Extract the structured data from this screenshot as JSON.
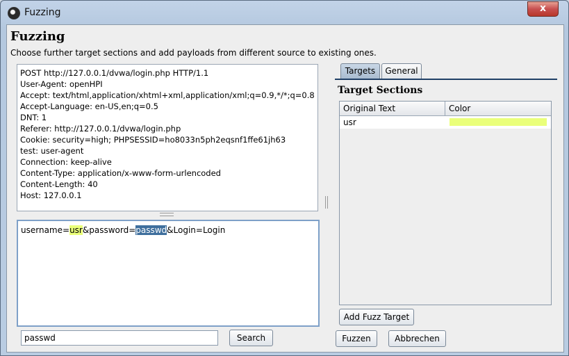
{
  "window": {
    "title": "Fuzzing",
    "close_label": "x"
  },
  "dialog": {
    "heading": "Fuzzing",
    "subtitle": "Choose further target sections and add payloads from different source to existing ones."
  },
  "request": {
    "header_lines": [
      "POST http://127.0.0.1/dvwa/login.php HTTP/1.1",
      "User-Agent: openHPI",
      "Accept: text/html,application/xhtml+xml,application/xml;q=0.9,*/*;q=0.8",
      "Accept-Language: en-US,en;q=0.5",
      "DNT: 1",
      "Referer: http://127.0.0.1/dvwa/login.php",
      "Cookie: security=high; PHPSESSID=ho8033n5ph2eqsnf1ffe61jh63",
      "test: user-agent",
      "Connection: keep-alive",
      "Content-Type: application/x-www-form-urlencoded",
      "Content-Length: 40",
      "Host: 127.0.0.1"
    ],
    "body": {
      "part1": "username=",
      "highlight_usr": "usr",
      "part2": "&password=",
      "selected": "passwd",
      "part3": "&Login=Login"
    }
  },
  "search": {
    "value": "passwd",
    "button_label": "Search"
  },
  "tabs": [
    {
      "label": "Targets",
      "active": true
    },
    {
      "label": "General",
      "active": false
    }
  ],
  "targets": {
    "heading": "Target Sections",
    "columns": [
      "Original Text",
      "Color"
    ],
    "rows": [
      {
        "original_text": "usr",
        "color": "#eaff7a"
      }
    ],
    "add_button_label": "Add Fuzz Target"
  },
  "footer": {
    "fuzzen_label": "Fuzzen",
    "abbrechen_label": "Abbrechen"
  }
}
